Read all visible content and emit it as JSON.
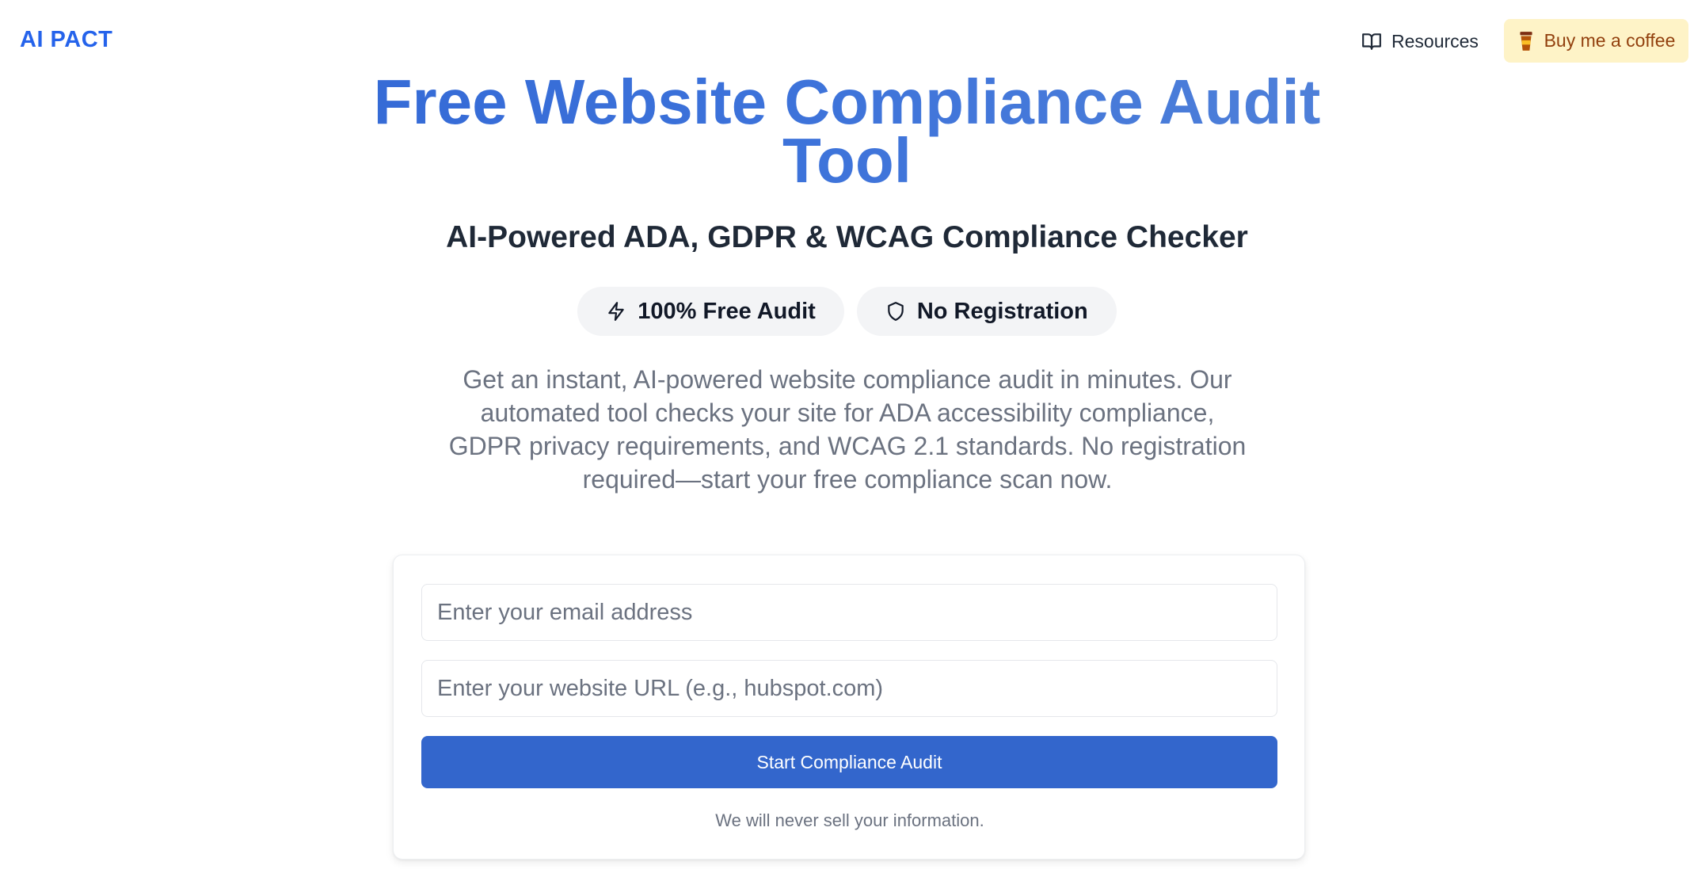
{
  "header": {
    "logo": "AI PACT",
    "resources_label": "Resources",
    "coffee_label": "Buy me a coffee"
  },
  "hero": {
    "title_line1": "Free Website Compliance Audit",
    "title_line2": "Tool",
    "subtitle": "AI-Powered ADA, GDPR & WCAG Compliance Checker",
    "badges": [
      {
        "label": "100% Free Audit",
        "icon": "lightning-icon"
      },
      {
        "label": "No Registration",
        "icon": "shield-icon"
      }
    ],
    "description": "Get an instant, AI-powered website compliance audit in minutes. Our automated tool checks your site for ADA accessibility compliance, GDPR privacy requirements, and WCAG 2.1 standards. No registration required—start your free compliance scan now."
  },
  "form": {
    "email_placeholder": "Enter your email address",
    "email_value": "",
    "url_placeholder": "Enter your website URL (e.g., hubspot.com)",
    "url_value": "",
    "submit_label": "Start Compliance Audit",
    "privacy_note": "We will never sell your information."
  },
  "colors": {
    "brand": "#2563eb",
    "button": "#3366cc",
    "coffee_bg": "#fef3c7",
    "coffee_text": "#92400e"
  }
}
